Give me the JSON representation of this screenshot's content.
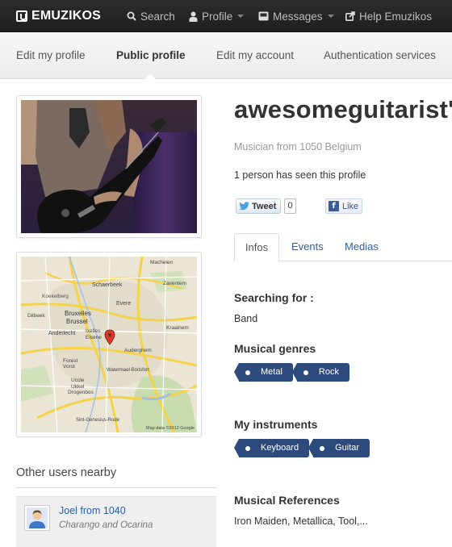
{
  "topnav": {
    "logo": "EMUZIKOS",
    "search": "Search",
    "profile": "Profile",
    "messages": "Messages",
    "help": "Help Emuzikos"
  },
  "subnav": {
    "items": [
      "Edit my profile",
      "Public profile",
      "Edit my account",
      "Authentication services"
    ],
    "active": "Public profile"
  },
  "profile": {
    "username": "awesomeguitarist'",
    "location": "Musician from 1050 Belgium",
    "views": "1 person has seen this profile"
  },
  "social": {
    "tweet_label": "Tweet",
    "tweet_count": "0",
    "like_label": "Like"
  },
  "tabs": [
    "Infos",
    "Events",
    "Medias"
  ],
  "info": {
    "searching_title": "Searching for :",
    "searching_value": "Band",
    "genres_title": "Musical genres",
    "genres": [
      "Metal",
      "Rock"
    ],
    "instruments_title": "My instruments",
    "instruments": [
      "Keyboard",
      "Guitar"
    ],
    "references_title": "Musical References",
    "references_value": "Iron Maiden, Metallica, Tool,..."
  },
  "map": {
    "labels": [
      "Koekelberg",
      "Schaerbeek",
      "Bruxelles",
      "Brussel",
      "Ixelles",
      "Elsene",
      "Anderlecht",
      "Evere",
      "Forest",
      "Vorst",
      "Uccle",
      "Ukkel",
      "Auderghem",
      "Watermael-Boitsfort",
      "Kraainem",
      "Zaventem",
      "Dilbeek",
      "Machelen",
      "Drogenbos",
      "Sint-Genesius-Rode"
    ],
    "copyright": "Map data ©2012 Google"
  },
  "nearby": {
    "title": "Other users nearby",
    "users": [
      {
        "name": "Joel from 1040",
        "instruments": "Charango and Ocarina"
      }
    ]
  },
  "colors": {
    "accent": "#2c5fa6",
    "tag_bg": "#2d4a7d",
    "topbar_bg": "#222222"
  }
}
